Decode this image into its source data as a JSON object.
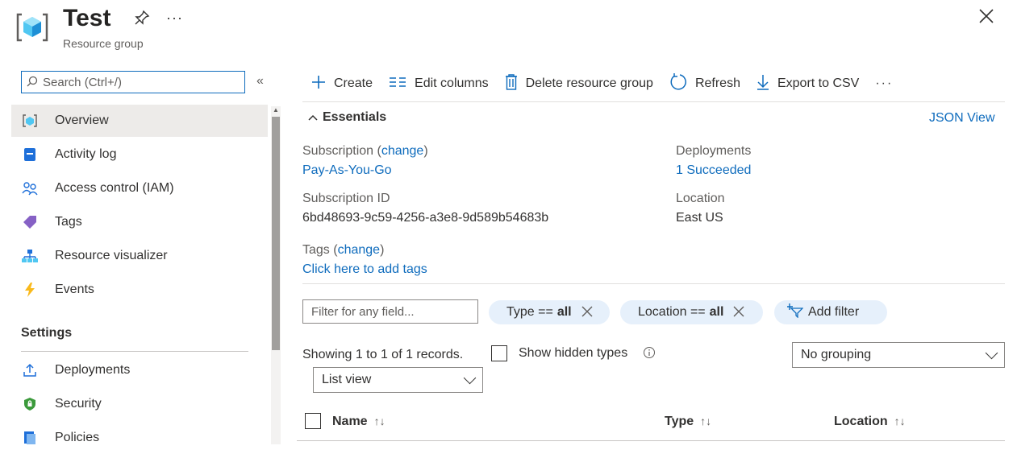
{
  "header": {
    "title": "Test",
    "subtitle": "Resource group",
    "more": "···"
  },
  "sidebar": {
    "search_placeholder": "Search (Ctrl+/)",
    "collapse": "«",
    "items": [
      {
        "label": "Overview"
      },
      {
        "label": "Activity log"
      },
      {
        "label": "Access control (IAM)"
      },
      {
        "label": "Tags"
      },
      {
        "label": "Resource visualizer"
      },
      {
        "label": "Events"
      }
    ],
    "section_settings": "Settings",
    "settings_items": [
      {
        "label": "Deployments"
      },
      {
        "label": "Security"
      },
      {
        "label": "Policies"
      }
    ]
  },
  "toolbar": {
    "create": "Create",
    "edit_columns": "Edit columns",
    "delete": "Delete resource group",
    "refresh": "Refresh",
    "export": "Export to CSV",
    "more": "···"
  },
  "essentials": {
    "title": "Essentials",
    "json_view": "JSON View",
    "subscription_label": "Subscription",
    "change": "change",
    "subscription_value": "Pay-As-You-Go",
    "subscription_id_label": "Subscription ID",
    "subscription_id_value": "6bd48693-9c59-4256-a3e8-9d589b54683b",
    "tags_label": "Tags",
    "tags_value": "Click here to add tags",
    "deployments_label": "Deployments",
    "deployments_value": "1 Succeeded",
    "location_label": "Location",
    "location_value": "East US"
  },
  "filters": {
    "filter_placeholder": "Filter for any field...",
    "type_pill_prefix": "Type ==",
    "type_pill_value": "all",
    "location_pill_prefix": "Location ==",
    "location_pill_value": "all",
    "add_filter": "Add filter"
  },
  "records": {
    "showing": "Showing 1 to 1 of 1 records.",
    "show_hidden": "Show hidden types",
    "grouping": "No grouping",
    "view": "List view"
  },
  "table": {
    "columns": [
      "Name",
      "Type",
      "Location"
    ]
  },
  "colors": {
    "accent": "#0f6cbd",
    "pill_bg": "#e6f0fb",
    "active_nav": "#edebe9"
  }
}
